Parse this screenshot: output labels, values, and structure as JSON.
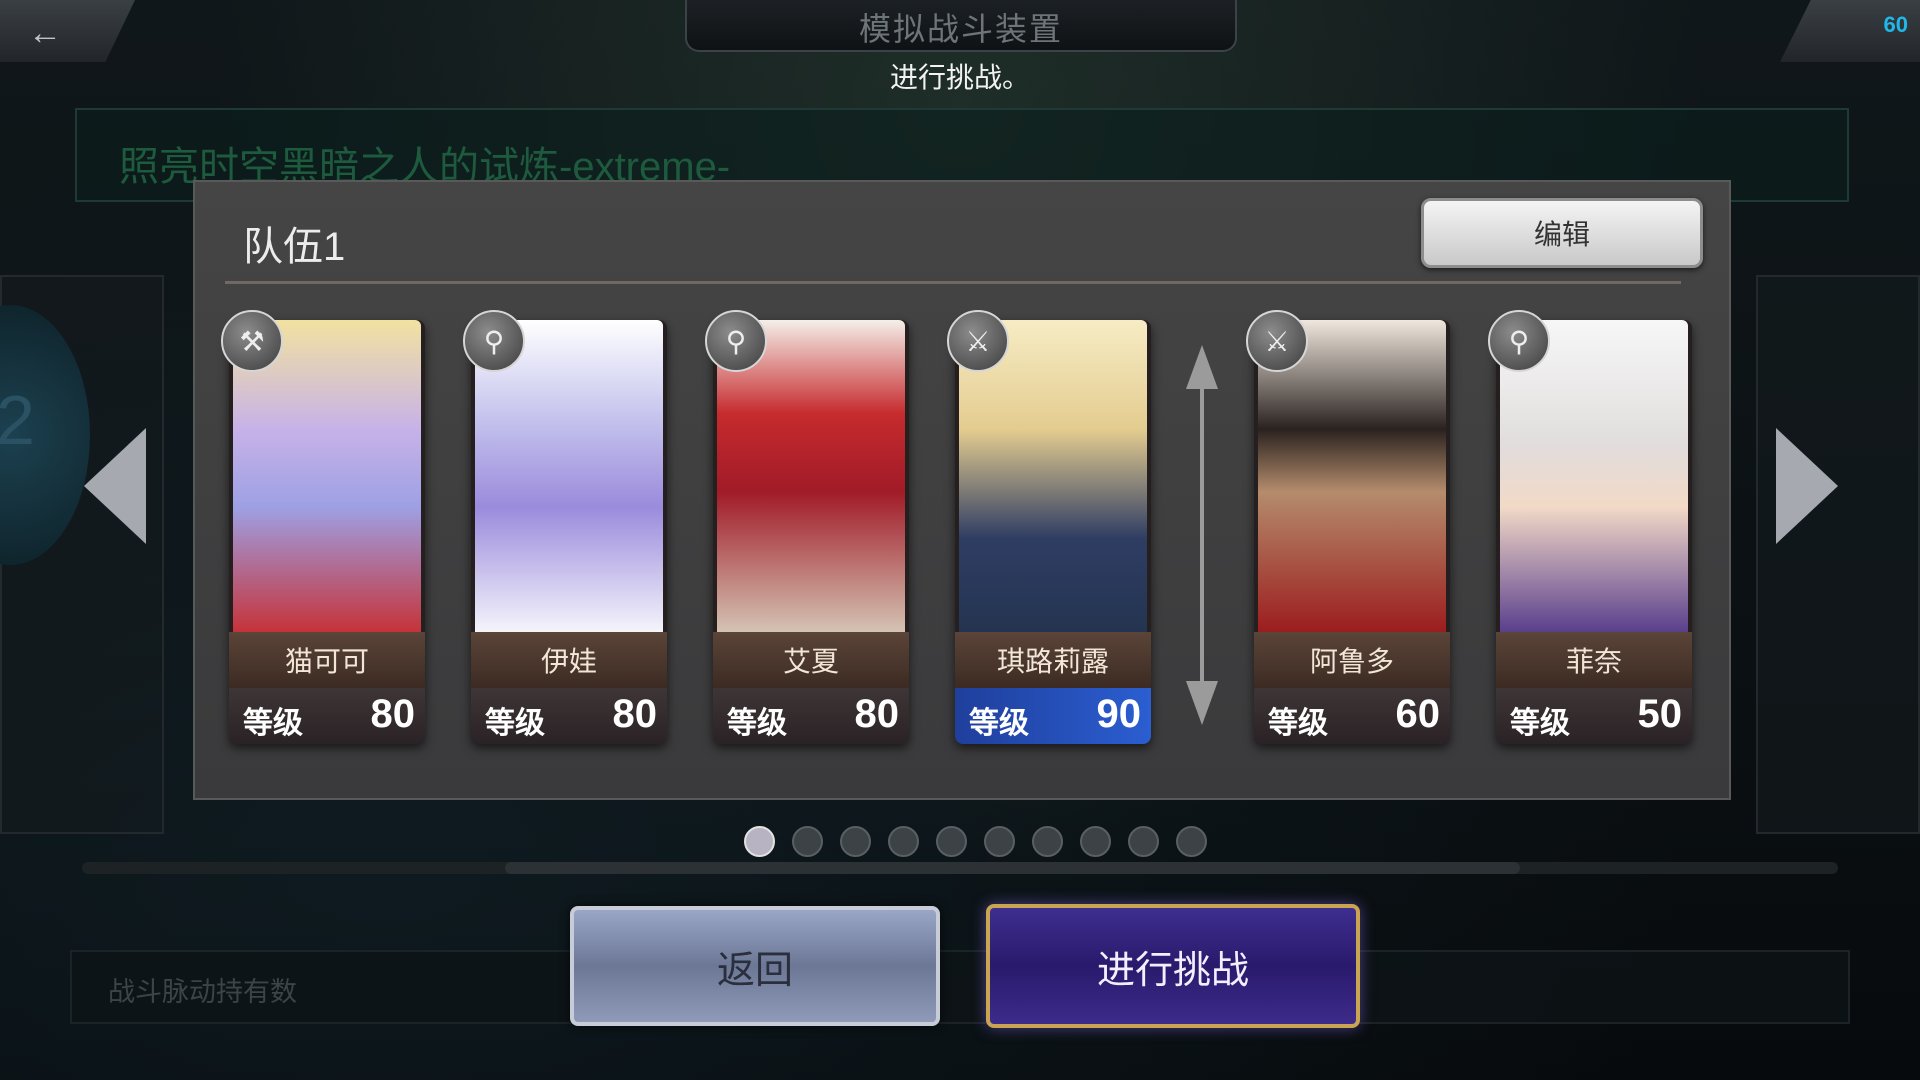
{
  "header": {
    "title": "模拟战斗装置",
    "subtitle": "进行挑战。",
    "fps": "60"
  },
  "quest": {
    "name": "照亮时空黑暗之人的试炼-extreme-"
  },
  "side": {
    "left_number": "2"
  },
  "team": {
    "title": "队伍1",
    "edit_label": "编辑",
    "members": [
      {
        "name": "猫可可",
        "level_label": "等级",
        "level": "80",
        "weapon_icon": "axe-icon"
      },
      {
        "name": "伊娃",
        "level_label": "等级",
        "level": "80",
        "weapon_icon": "staff-icon"
      },
      {
        "name": "艾夏",
        "level_label": "等级",
        "level": "80",
        "weapon_icon": "staff-icon"
      },
      {
        "name": "琪路莉露",
        "level_label": "等级",
        "level": "90",
        "weapon_icon": "sword-icon"
      },
      {
        "name": "阿鲁多",
        "level_label": "等级",
        "level": "60",
        "weapon_icon": "sword-icon"
      },
      {
        "name": "菲奈",
        "level_label": "等级",
        "level": "50",
        "weapon_icon": "staff-icon"
      }
    ]
  },
  "pager": {
    "total": 10,
    "active": 1
  },
  "info": {
    "text": "战斗脉动持有数"
  },
  "buttons": {
    "back_label": "返回",
    "challenge_label": "进行挑战"
  },
  "colors": {
    "fps": "#1fb8e8",
    "challenge_border": "#c9a453",
    "challenge_bg": "#2a1a6c"
  }
}
